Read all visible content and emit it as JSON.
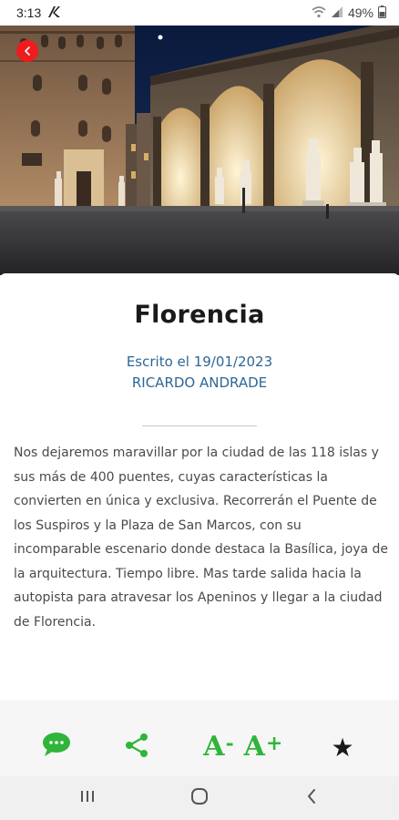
{
  "status_bar": {
    "time": "3:13",
    "battery": "49%",
    "icons": [
      "carrier-logo-icon",
      "wifi-icon",
      "signal-icon",
      "battery-icon"
    ]
  },
  "hero": {
    "back_icon": "arrow-left-icon",
    "accent": "#ee1c1c"
  },
  "article": {
    "title": "Florencia",
    "date": "Escrito el 19/01/2023",
    "author": "RICARDO ANDRADE",
    "body": "Nos dejaremos maravillar por la ciudad de las 118 islas y sus más de 400 puentes, cuyas características la convierten en única y exclusiva. Recorrerán el Puente de los Suspiros y la Plaza de San Marcos, con su incomparable escenario donde destaca la Basílica, joya de la arquitectura. Tiempo libre. Mas tarde salida hacia la autopista para atravesar los Apeninos y llegar a la ciudad de Florencia.",
    "meta_color": "#2d6796"
  },
  "toolbar": {
    "chat_icon": "chat-bubble-icon",
    "share_icon": "share-icon",
    "font_decrease": {
      "letter": "A",
      "sign": "-"
    },
    "font_increase": {
      "letter": "A",
      "sign": "+"
    },
    "favorite_icon": "star-icon",
    "favorite_glyph": "★",
    "accent": "#2fb53a"
  },
  "navbar": {
    "icons": [
      "recent-apps-icon",
      "home-icon",
      "back-icon"
    ]
  }
}
